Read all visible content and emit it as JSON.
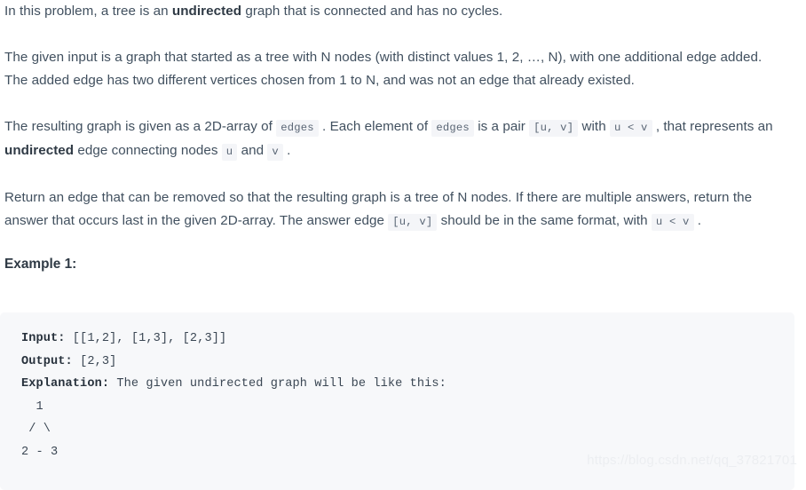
{
  "document": {
    "paragraphs": [
      {
        "id": "intro",
        "parts": [
          {
            "type": "text",
            "value": "In this problem, a tree is an "
          },
          {
            "type": "bold",
            "value": "undirected"
          },
          {
            "type": "text",
            "value": " graph that is connected and has no cycles."
          }
        ]
      },
      {
        "id": "input-description",
        "parts": [
          {
            "type": "text",
            "value": "The given input is a graph that started as a tree with N nodes (with distinct values 1, 2, …, N), with one additional edge added. The added edge has two different vertices chosen from 1 to N, and was not an edge that already existed."
          }
        ]
      },
      {
        "id": "edges-description",
        "parts": [
          {
            "type": "text",
            "value": "The resulting graph is given as a 2D-array of "
          },
          {
            "type": "code",
            "value": "edges"
          },
          {
            "type": "text",
            "value": " . Each element of "
          },
          {
            "type": "code",
            "value": "edges"
          },
          {
            "type": "text",
            "value": " is a pair "
          },
          {
            "type": "code",
            "value": "[u, v]"
          },
          {
            "type": "text",
            "value": " with "
          },
          {
            "type": "code",
            "value": "u < v"
          },
          {
            "type": "text",
            "value": " , that represents an "
          },
          {
            "type": "bold",
            "value": "undirected"
          },
          {
            "type": "text",
            "value": " edge connecting nodes "
          },
          {
            "type": "code",
            "value": "u"
          },
          {
            "type": "text",
            "value": " and "
          },
          {
            "type": "code",
            "value": "v"
          },
          {
            "type": "text",
            "value": " ."
          }
        ]
      },
      {
        "id": "return-description",
        "parts": [
          {
            "type": "text",
            "value": "Return an edge that can be removed so that the resulting graph is a tree of N nodes. If there are multiple answers, return the answer that occurs last in the given 2D-array. The answer edge "
          },
          {
            "type": "code",
            "value": "[u, v]"
          },
          {
            "type": "text",
            "value": " should be in the same format, with "
          },
          {
            "type": "code",
            "value": "u < v"
          },
          {
            "type": "text",
            "value": " ."
          }
        ]
      }
    ],
    "example_heading": "Example 1:",
    "code_block": {
      "lines": [
        {
          "label": "Input:",
          "rest": " [[1,2], [1,3], [2,3]]"
        },
        {
          "label": "Output:",
          "rest": " [2,3]"
        },
        {
          "label": "Explanation:",
          "rest": " The given undirected graph will be like this:"
        },
        {
          "label": "",
          "rest": "  1"
        },
        {
          "label": "",
          "rest": " / \\"
        },
        {
          "label": "",
          "rest": "2 - 3"
        }
      ]
    },
    "watermark": "https://blog.csdn.net/qq_37821701",
    "colors": {
      "body_text": "#41505f",
      "bold_text": "#2f3a45",
      "code_chip_bg": "#f4f5f8",
      "code_block_bg": "#f7f8fa",
      "code_text": "#3b4754",
      "watermark": "#eceef1",
      "page_bg": "#ffffff"
    }
  }
}
